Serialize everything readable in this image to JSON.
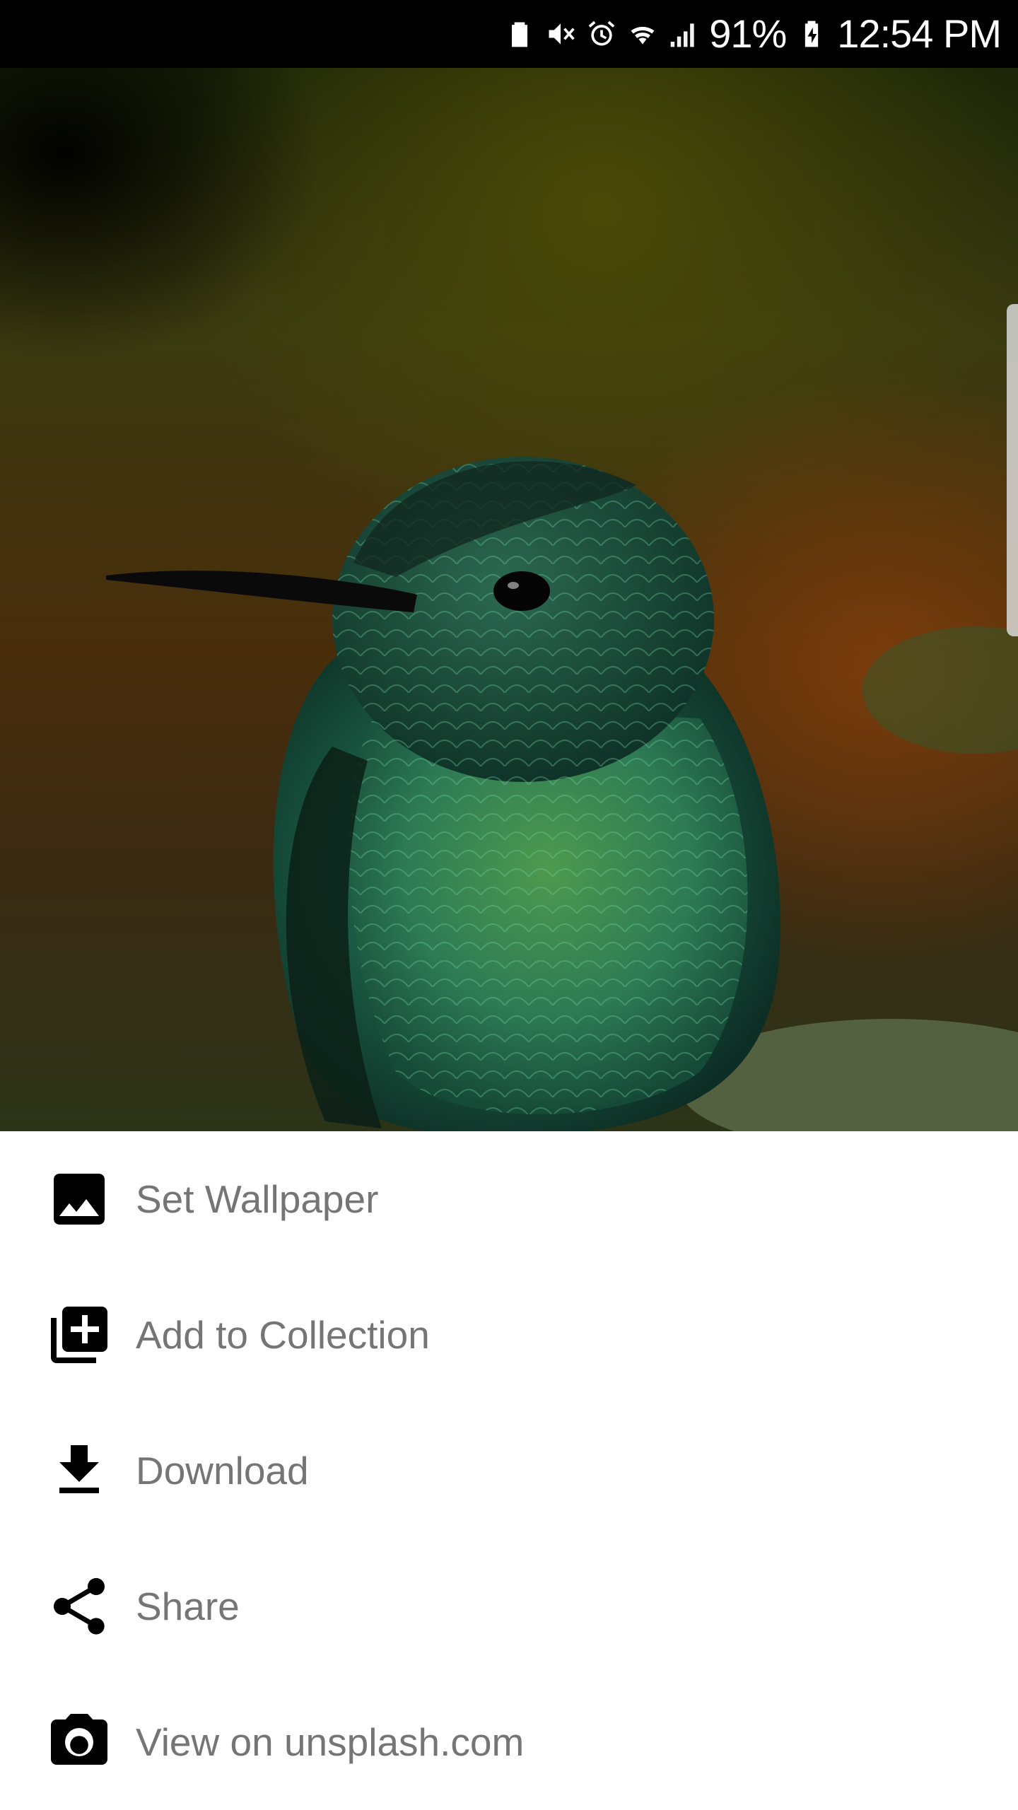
{
  "status_bar": {
    "icons": [
      "battery-saver-icon",
      "mute-icon",
      "alarm-icon",
      "wifi-icon",
      "signal-icon",
      "charging-battery-icon"
    ],
    "battery_percent": "91%",
    "time": "12:54 PM"
  },
  "photo": {
    "subject": "hummingbird-photo"
  },
  "menu": {
    "items": [
      {
        "label": "Set Wallpaper",
        "icon": "wallpaper-icon"
      },
      {
        "label": "Add to Collection",
        "icon": "add-to-collection-icon"
      },
      {
        "label": "Download",
        "icon": "download-icon"
      },
      {
        "label": "Share",
        "icon": "share-icon"
      },
      {
        "label": "View on unsplash.com",
        "icon": "camera-icon"
      }
    ]
  },
  "colors": {
    "status_bar_bg": "#000000",
    "sheet_bg": "#ffffff",
    "menu_label": "#757575",
    "menu_icon": "#000000"
  }
}
